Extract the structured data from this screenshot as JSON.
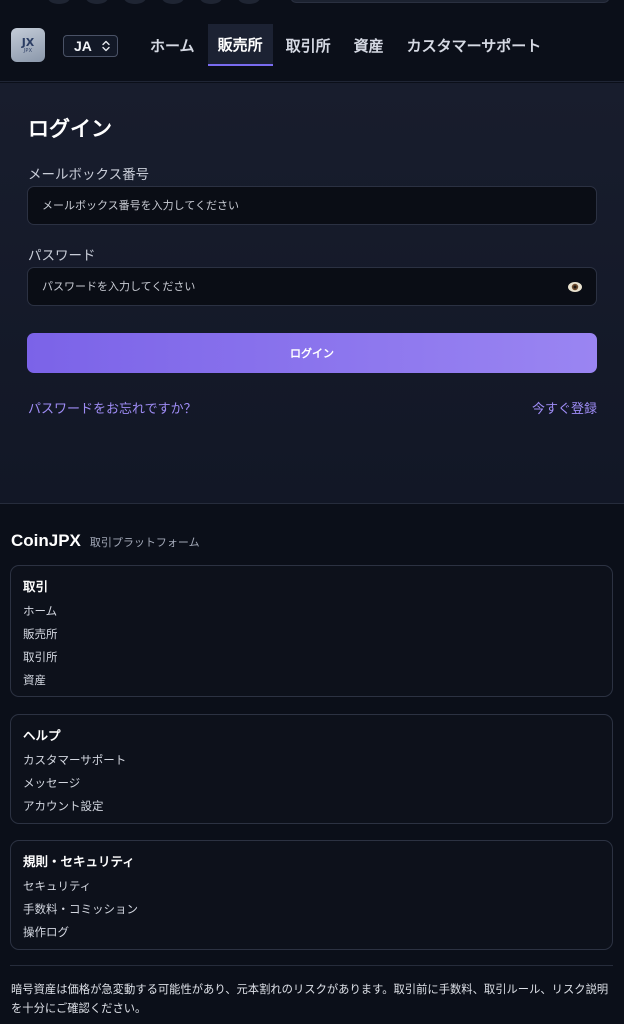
{
  "header": {
    "logo_mark": "JX",
    "logo_sub": "JPX",
    "language": "JA",
    "nav": [
      {
        "label": "ホーム",
        "active": false
      },
      {
        "label": "販売所",
        "active": true
      },
      {
        "label": "取引所",
        "active": false
      },
      {
        "label": "資産",
        "active": false
      },
      {
        "label": "カスタマーサポート",
        "active": false
      }
    ]
  },
  "login": {
    "title": "ログイン",
    "email_label": "メールボックス番号",
    "email_placeholder": "メールボックス番号を入力してください",
    "password_label": "パスワード",
    "password_placeholder": "パスワードを入力してください",
    "submit_label": "ログイン",
    "forgot_label": "パスワードをお忘れですか？",
    "register_label": "今すぐ登録"
  },
  "footer": {
    "brand": "CoinJPX",
    "tagline": "取引プラットフォーム",
    "sections": [
      {
        "title": "取引",
        "links": [
          "ホーム",
          "販売所",
          "取引所",
          "資産"
        ]
      },
      {
        "title": "ヘルプ",
        "links": [
          "カスタマーサポート",
          "メッセージ",
          "アカウント設定"
        ]
      },
      {
        "title": "規則・セキュリティ",
        "links": [
          "セキュリティ",
          "手数料・コミッション",
          "操作ログ"
        ]
      }
    ],
    "disclaimer": "暗号資産は価格が急変動する可能性があり、元本割れのリスクがあります。取引前に手数料、取引ルール、リスク説明を十分にご確認ください。"
  },
  "colors": {
    "background": "#0b0f19",
    "accent": "#7b63e8",
    "link": "#9f8cf6"
  },
  "icons": {
    "language_toggle": "chevron-updown-icon",
    "password_toggle": "eye-icon"
  }
}
